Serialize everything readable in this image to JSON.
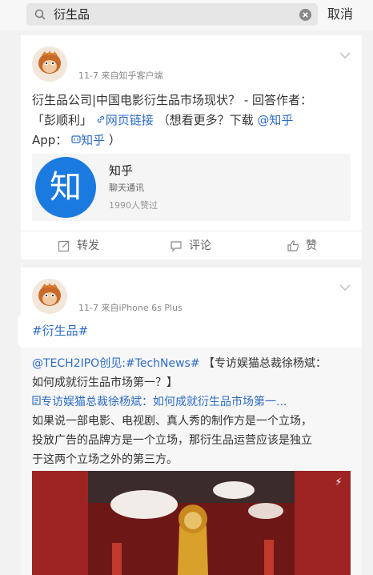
{
  "search": {
    "query": "衍生品",
    "cancel_label": "取消"
  },
  "posts": [
    {
      "username": "",
      "meta": "11-7  来自知乎客户端",
      "line1": "衍生品公司|中国电影衍生品市场现状？ - 回答作者：",
      "line2_a": "「彭顺利」",
      "line2_link": "网页链接",
      "line2_b": "（想看更多？下载",
      "line2_mention": "@知乎",
      "line3_a": "App：",
      "line3_link": "知乎",
      "line3_b": "）",
      "app_card": {
        "name": "知乎",
        "logo_text": "知",
        "category": "聊天通讯",
        "likes": "1990人赞过"
      },
      "actions": {
        "repost": "转发",
        "comment": "评论",
        "like": "赞"
      }
    },
    {
      "username": "",
      "meta": "11-7  来自iPhone 6s Plus",
      "hashtag": "#衍生品#",
      "repost_mention": "@TECH2IPO创见:",
      "repost_tag": "#TechNews#",
      "repost_line1_rest": " 【专访娱猫总裁徐杨斌：",
      "repost_line2": "如何成就衍生品市场第一？】",
      "repost_link": "专访娱猫总裁徐杨斌：如何成就衍生品市场第一...",
      "repost_body1": "如果说一部电影、电视剧、真人秀的制作方是一个立场，",
      "repost_body2": "投放广告的品牌方是一个立场，那衍生品运营应该是独立",
      "repost_body3": "于这两个立场之外的第三方。"
    }
  ],
  "icons": [
    "search-icon",
    "clear-icon",
    "chevron-down-icon",
    "link-icon",
    "app-icon",
    "repost-icon",
    "comment-icon",
    "like-icon",
    "article-icon",
    "photo-badge-icon"
  ],
  "colors": {
    "link": "#2d6cc4",
    "app_logo": "#1a7ae0"
  }
}
